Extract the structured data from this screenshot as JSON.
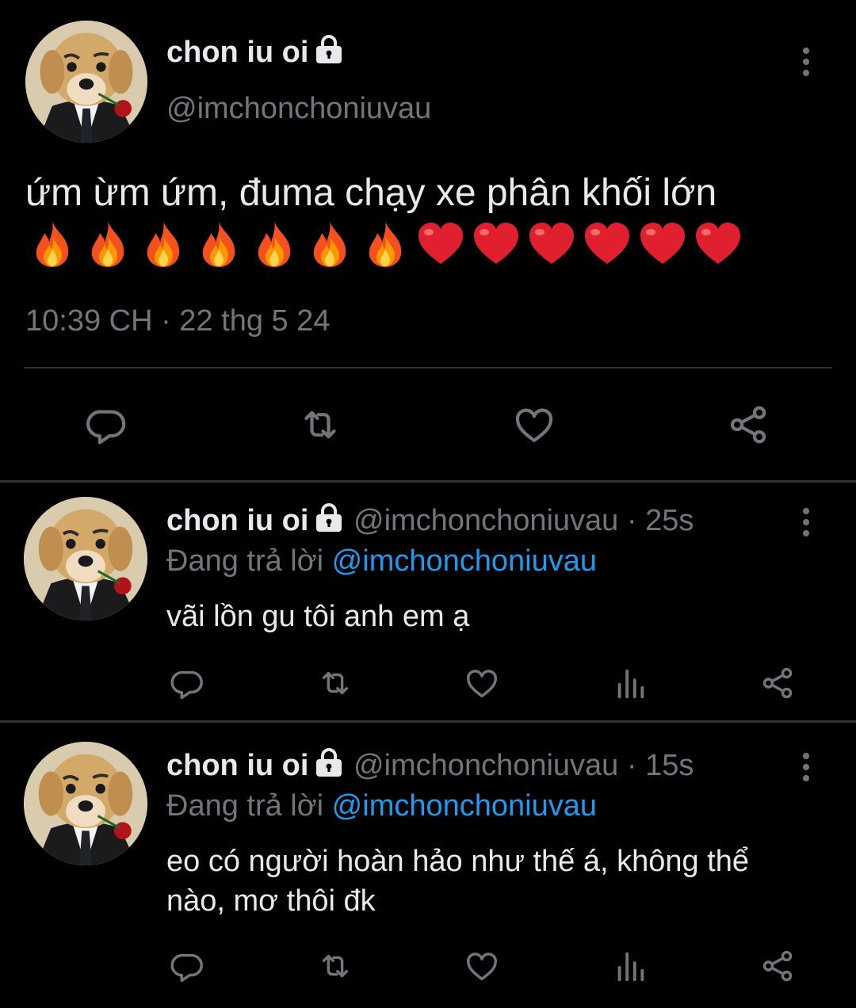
{
  "main_tweet": {
    "display_name": "chon iu oi",
    "handle": "@imchonchoniuvau",
    "text": "ứm ừm ứm, đuma chạy xe phân khối lớn",
    "emojis": [
      "fire",
      "fire",
      "fire",
      "fire",
      "fire",
      "fire",
      "fire",
      "red-heart",
      "red-heart",
      "red-heart",
      "red-heart",
      "red-heart",
      "red-heart"
    ],
    "timestamp": "10:39 CH · 22 thg 5 24",
    "actions": [
      "reply-icon",
      "retweet-icon",
      "like-icon",
      "share-icon"
    ]
  },
  "replies": [
    {
      "display_name": "chon iu oi",
      "handle": "@imchonchoniuvau",
      "age": "· 25s",
      "replying_prefix": "Đang trả lời",
      "replying_to": "@imchonchoniuvau",
      "text": "vãi lồn gu tôi anh em ạ"
    },
    {
      "display_name": "chon iu oi",
      "handle": "@imchonchoniuvau",
      "age": "· 15s",
      "replying_prefix": "Đang trả lời",
      "replying_to": "@imchonchoniuvau",
      "text": "eo có người hoàn hảo như thế á, không thể nào, mơ thôi đk"
    }
  ],
  "colors": {
    "background": "#000000",
    "text": "#e7e9ea",
    "muted": "#71767b",
    "link": "#1d9bf0",
    "divider": "#2f3336"
  }
}
